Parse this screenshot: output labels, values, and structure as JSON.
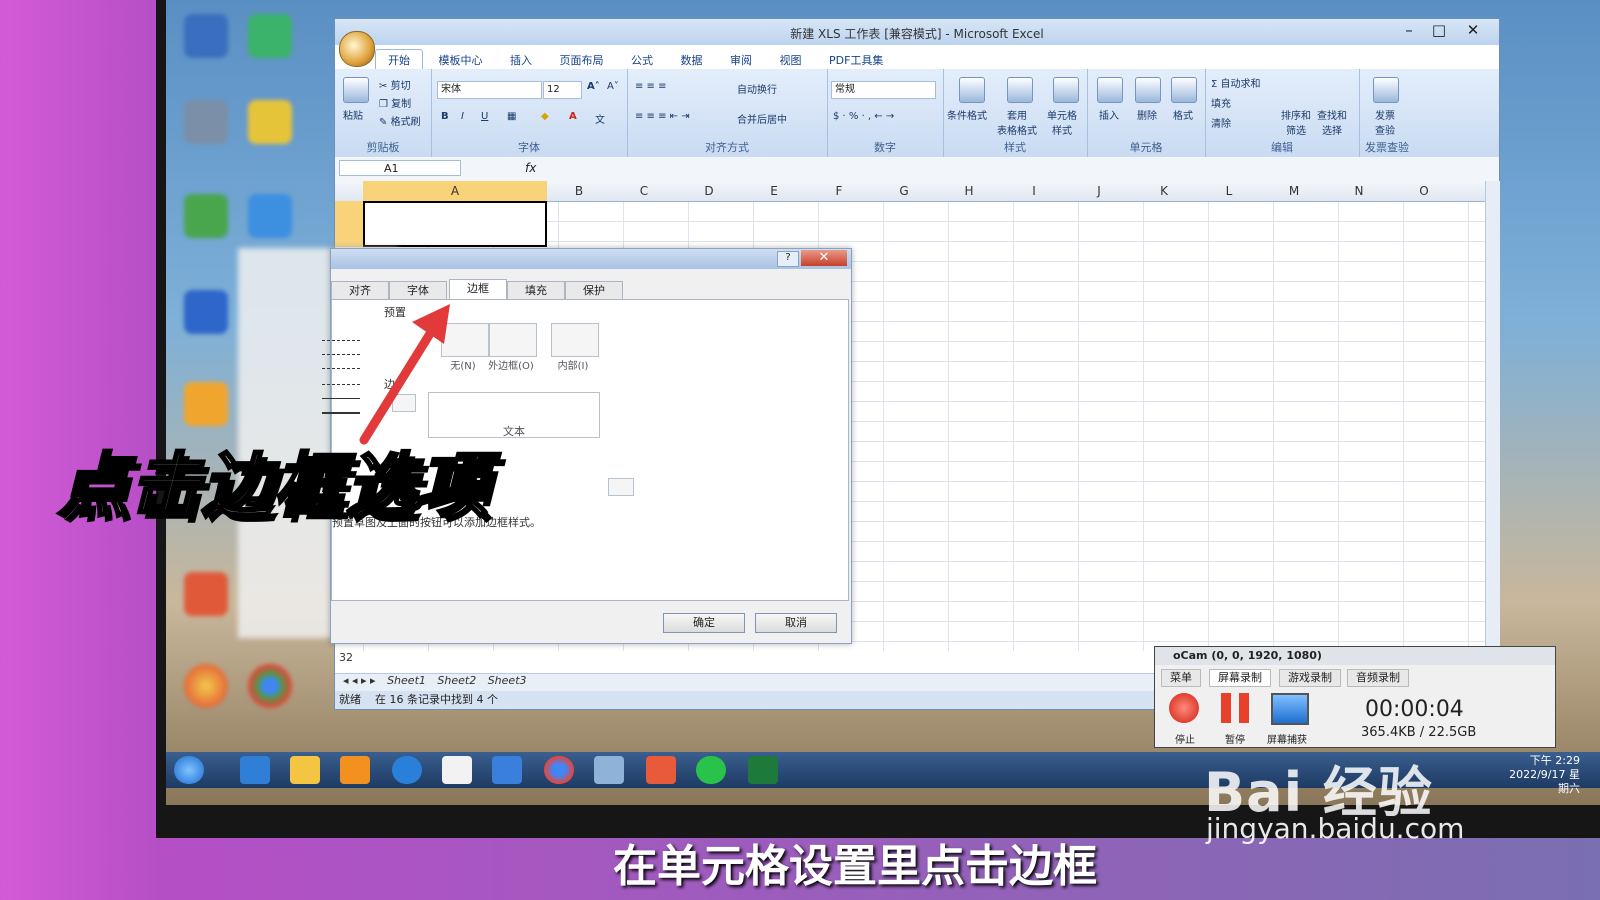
{
  "excel": {
    "title": "新建 XLS 工作表 [兼容模式] - Microsoft Excel",
    "tabs": [
      "开始",
      "模板中心",
      "插入",
      "页面布局",
      "公式",
      "数据",
      "审阅",
      "视图",
      "PDF工具集"
    ],
    "ribbon": {
      "clipboard": {
        "paste": "粘贴",
        "cut": "剪切",
        "copy": "复制",
        "format_painter": "格式刷",
        "label": "剪贴板"
      },
      "font": {
        "name": "宋体",
        "size": "12",
        "label": "字体"
      },
      "alignment": {
        "wrap": "自动换行",
        "merge": "合并后居中",
        "label": "对齐方式"
      },
      "number": {
        "format": "常规",
        "label": "数字"
      },
      "styles": {
        "conditional": "条件格式",
        "table": "套用\n表格格式",
        "cell": "单元格\n样式",
        "label": "样式"
      },
      "cells": {
        "insert": "插入",
        "delete": "删除",
        "format": "格式",
        "label": "单元格"
      },
      "editing": {
        "autosum": "自动求和",
        "fill": "填充",
        "clear": "清除",
        "sort": "排序和\n筛选",
        "find": "查找和\n选择",
        "label": "编辑"
      },
      "invoice": {
        "check": "发票\n查验",
        "label": "发票查验"
      }
    },
    "name_box": "A1",
    "fx": "fx",
    "columns": [
      "A",
      "B",
      "C",
      "D",
      "E",
      "F",
      "G",
      "H",
      "I",
      "J",
      "K",
      "L",
      "M",
      "N",
      "O"
    ],
    "row_label": "32",
    "sheets": [
      "Sheet1",
      "Sheet2",
      "Sheet3"
    ],
    "status_ready": "就绪",
    "status_msg": "在 16 条记录中找到 4 个"
  },
  "dialog": {
    "tabs": [
      "对齐",
      "字体",
      "边框",
      "填充",
      "保护"
    ],
    "active_tab": "边框",
    "preset_label": "预置",
    "presets": [
      "无(N)",
      "外边框(O)",
      "内部(I)"
    ],
    "border_label": "边",
    "preview_text": "文本",
    "hint": "预置草图及上面的按钮可以添加边框样式。",
    "ok": "确定",
    "cancel": "取消",
    "close": "✕",
    "help": "?"
  },
  "ocam": {
    "title": "oCam (0, 0, 1920, 1080)",
    "tabs": [
      "菜单",
      "屏幕录制",
      "游戏录制",
      "音频录制"
    ],
    "active_tab": "屏幕录制",
    "stop": "停止",
    "pause": "暂停",
    "capture": "屏幕捕获",
    "time": "00:00:04",
    "size": "365.4KB / 22.5GB"
  },
  "taskbar": {
    "time": "下午 2:29",
    "date": "2022/9/17 星期六"
  },
  "overlay": {
    "headline": "点击边框选项",
    "subtitle": "在单元格设置里点击边框",
    "watermark": "Bai 经验",
    "watermark_url": "jingyan.baidu.com"
  },
  "colors": {
    "accent_arrow": "#e23a3a",
    "excel_blue": "#15428b",
    "selected": "#f8d37a"
  }
}
